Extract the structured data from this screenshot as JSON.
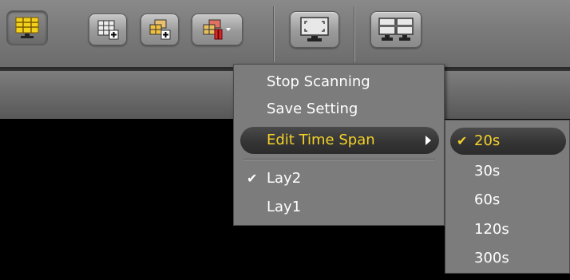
{
  "toolbar": {
    "buttons": [
      {
        "icon": "monitor-grid-icon",
        "active": true
      },
      {
        "icon": "add-layout-icon"
      },
      {
        "icon": "add-group-icon"
      },
      {
        "icon": "scan-layout-dropdown-icon"
      },
      {
        "icon": "fullscreen-monitor-icon"
      },
      {
        "icon": "dual-monitor-icon"
      }
    ]
  },
  "menu": {
    "items": [
      {
        "label": "Stop Scanning"
      },
      {
        "label": "Save Setting"
      },
      {
        "label": "Edit Time Span",
        "submenu": true,
        "highlighted": true
      },
      {
        "label": "Lay2",
        "checked": true
      },
      {
        "label": "Lay1"
      }
    ]
  },
  "submenu": {
    "items": [
      {
        "label": "20s",
        "checked": true,
        "highlighted": true
      },
      {
        "label": "30s"
      },
      {
        "label": "60s"
      },
      {
        "label": "120s"
      },
      {
        "label": "300s"
      }
    ]
  },
  "colors": {
    "highlight_text": "#f4d12a",
    "menu_bg": "#7c7c7c",
    "toolbar_bg": "#7a7a7a",
    "icon_yellow": "#f2d21b",
    "icon_red": "#d62a2a"
  }
}
